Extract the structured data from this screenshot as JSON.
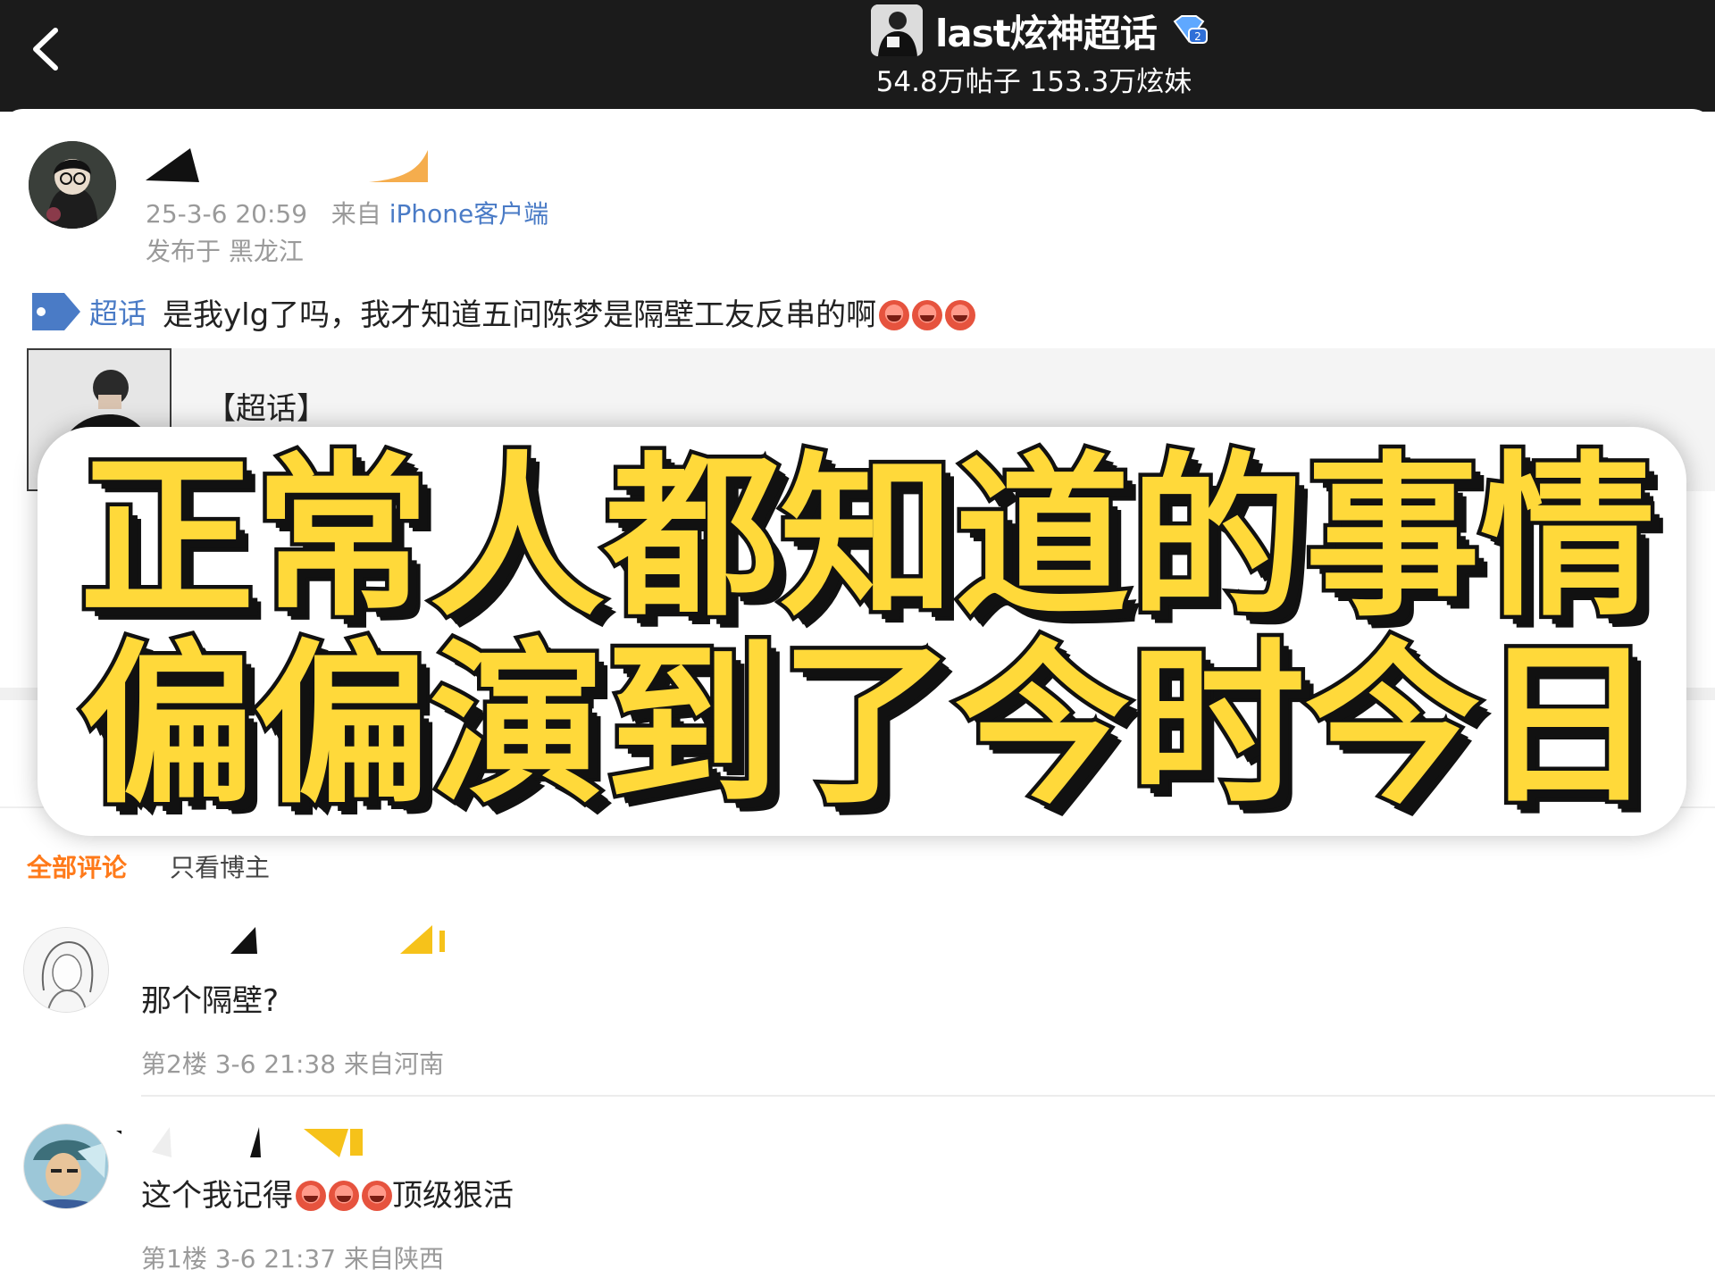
{
  "header": {
    "title": "last炫神超话",
    "stats": "54.8万帖子 153.3万炫妹"
  },
  "post": {
    "time": "25-3-6 20:59",
    "from_prefix": "来自",
    "client": "iPhone客户端",
    "location": "发布于 黑龙江",
    "topic_tag": "超话",
    "text": "是我ylg了吗，我才知道五问陈梦是隔壁工友反串的啊",
    "share_title": "【超话】"
  },
  "overlay": {
    "line1": "正常人都知道的事情",
    "line2": "偏偏演到了今时今日"
  },
  "comments_tabs": {
    "all": "全部评论",
    "only_author": "只看博主"
  },
  "comments": [
    {
      "text": "那个隔壁?",
      "meta": "第2楼 3-6 21:38 来自河南"
    },
    {
      "text": "这个我记得",
      "text_after": "顶级狠活",
      "meta": "第1楼 3-6 21:37 来自陕西"
    }
  ],
  "colors": {
    "topbar": "#1b1b1b",
    "link_blue": "#4a7bc6",
    "accent_orange": "#ff7a1a",
    "overlay_yellow": "#ffd93a"
  },
  "icons": [
    "back-chevron-icon",
    "vip-diamond-icon",
    "topic-tag-icon",
    "laugh-emoji-icon"
  ]
}
